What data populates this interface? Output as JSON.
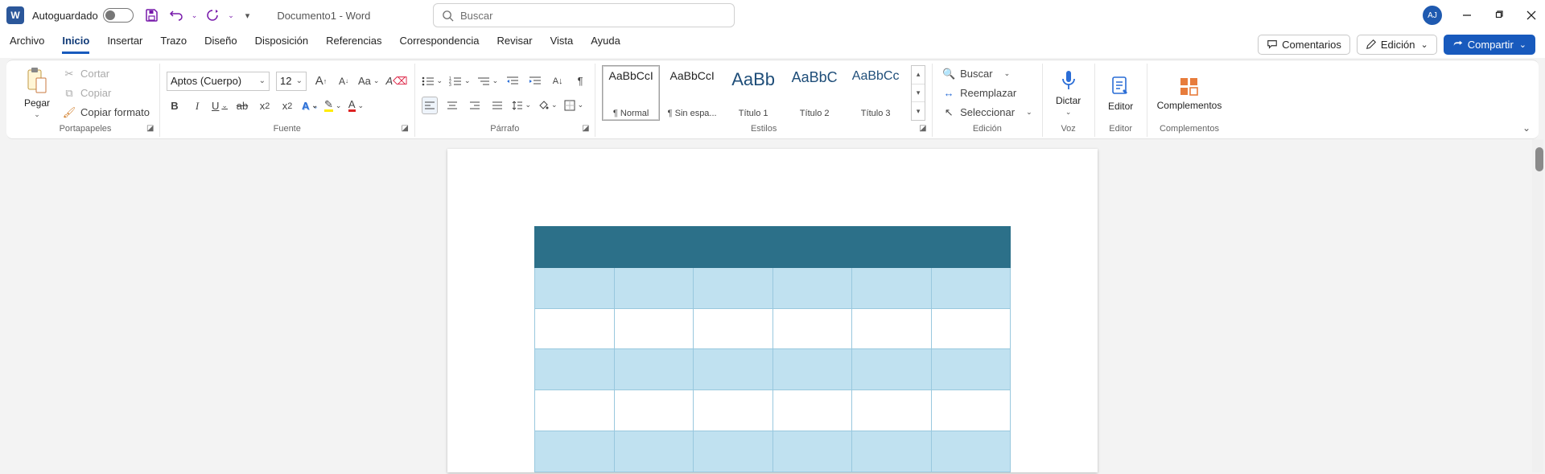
{
  "title_bar": {
    "word_icon_label": "W",
    "autosave_label": "Autoguardado",
    "doc_title": "Documento1  -  Word",
    "search_placeholder": "Buscar",
    "avatar_initials": "AJ"
  },
  "tabs": {
    "items": [
      {
        "label": "Archivo",
        "active": false
      },
      {
        "label": "Inicio",
        "active": true
      },
      {
        "label": "Insertar",
        "active": false
      },
      {
        "label": "Trazo",
        "active": false
      },
      {
        "label": "Diseño",
        "active": false
      },
      {
        "label": "Disposición",
        "active": false
      },
      {
        "label": "Referencias",
        "active": false
      },
      {
        "label": "Correspondencia",
        "active": false
      },
      {
        "label": "Revisar",
        "active": false
      },
      {
        "label": "Vista",
        "active": false
      },
      {
        "label": "Ayuda",
        "active": false
      }
    ],
    "right": {
      "comments": "Comentarios",
      "editing": "Edición",
      "share": "Compartir"
    }
  },
  "ribbon": {
    "clipboard": {
      "paste": "Pegar",
      "cut": "Cortar",
      "copy": "Copiar",
      "format_painter": "Copiar formato",
      "title": "Portapapeles"
    },
    "font": {
      "name": "Aptos (Cuerpo)",
      "size": "12",
      "title": "Fuente"
    },
    "paragraph": {
      "title": "Párrafo"
    },
    "styles": {
      "title": "Estilos",
      "items": [
        {
          "preview": "AaBbCcI",
          "caption": "¶ Normal",
          "big": false,
          "color": "#202020"
        },
        {
          "preview": "AaBbCcI",
          "caption": "¶ Sin espa...",
          "big": false,
          "color": "#202020"
        },
        {
          "preview": "AaBb",
          "caption": "Título 1",
          "big": true,
          "color": "#1f4e79"
        },
        {
          "preview": "AaBbC",
          "caption": "Título 2",
          "big": false,
          "color": "#1f4e79"
        },
        {
          "preview": "AaBbCc",
          "caption": "Título 3",
          "big": false,
          "color": "#1f4e79"
        }
      ]
    },
    "editing": {
      "find": "Buscar",
      "replace": "Reemplazar",
      "select": "Seleccionar",
      "title": "Edición"
    },
    "voice": {
      "dictate": "Dictar",
      "title": "Voz"
    },
    "editor": {
      "label": "Editor",
      "title": "Editor"
    },
    "addins": {
      "label": "Complementos",
      "title": "Complementos"
    }
  },
  "colors": {
    "accent": "#185abd",
    "purple": "#7719aa",
    "highlight_yellow": "#ffeb00",
    "font_red": "#d22"
  },
  "document": {
    "table": {
      "cols": 6,
      "rows": 6,
      "header_bg": "#2c7089",
      "band_bg": "#c0e1f0",
      "off_bg": "#ffffff"
    }
  }
}
